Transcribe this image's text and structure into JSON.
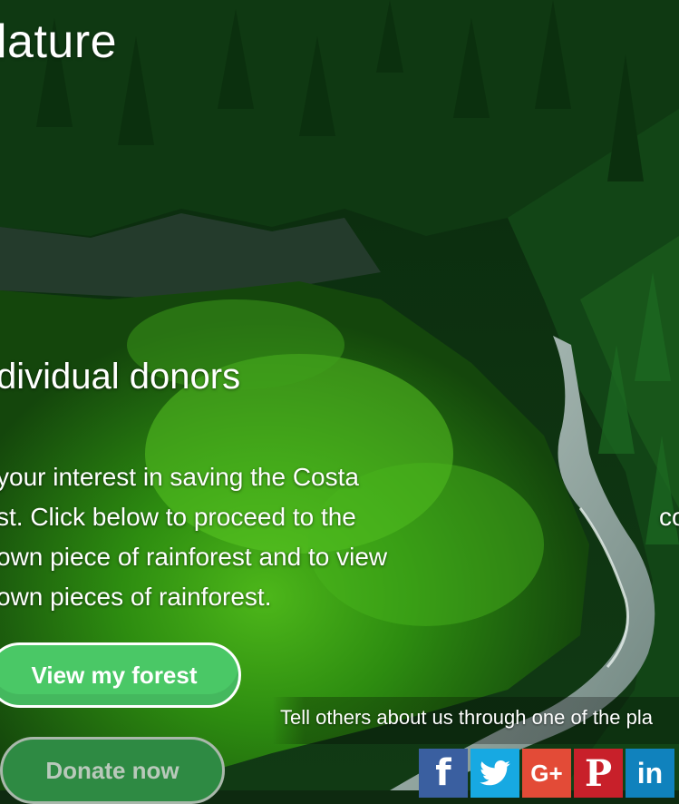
{
  "header": {
    "title": "lature"
  },
  "section": {
    "subtitle": "dividual donors",
    "paragraph_lines": [
      "your interest in saving the Costa",
      "st. Click below to proceed to the",
      "own piece of rainforest and to view",
      "own pieces of rainforest."
    ],
    "stray_text": "co"
  },
  "actions": {
    "view_forest_label": "View my forest",
    "donate_label": "Donate now"
  },
  "share": {
    "prompt": "Tell others about us through one of the pla",
    "icons": [
      {
        "name": "facebook-icon",
        "glyph": "f",
        "color": "#3a5fa0"
      },
      {
        "name": "twitter-icon",
        "glyph": "",
        "color": "#17a9e2"
      },
      {
        "name": "google-plus-icon",
        "glyph": "G+",
        "color": "#e34b37"
      },
      {
        "name": "pinterest-icon",
        "glyph": "P",
        "color": "#c8202a"
      },
      {
        "name": "linkedin-icon",
        "glyph": "in",
        "color": "#1082bd"
      }
    ]
  },
  "colors": {
    "view_button": "#4ac866",
    "donate_button": "#2e8a43"
  }
}
